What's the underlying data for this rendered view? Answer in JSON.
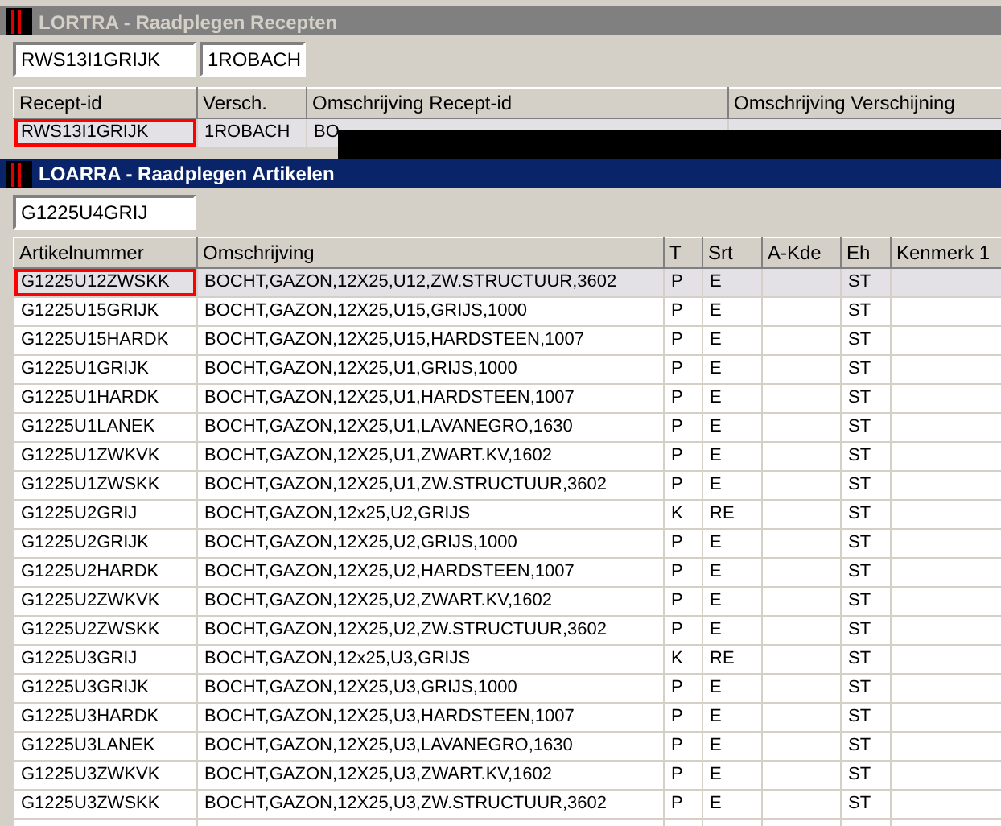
{
  "recipes_window": {
    "title": "LORTRA - Raadplegen Recepten",
    "filters": [
      "RWS13I1GRIJK",
      "1ROBACH"
    ],
    "columns": [
      "Recept-id",
      "Versch.",
      "Omschrijving Recept-id",
      "Omschrijving Verschijning"
    ],
    "rows": [
      {
        "cells": [
          "RWS13I1GRIJK",
          "1ROBACH",
          "BO",
          ""
        ],
        "selected": true
      }
    ]
  },
  "articles_window": {
    "title": "LOARRA - Raadplegen Artikelen",
    "filter": "G1225U4GRIJ",
    "columns": [
      "Artikelnummer",
      "Omschrijving",
      "T",
      "Srt",
      "A-Kde",
      "Eh",
      "Kenmerk 1"
    ],
    "rows": [
      {
        "cells": [
          "G1225U12ZWSKK",
          "BOCHT,GAZON,12X25,U12,ZW.STRUCTUUR,3602",
          "P",
          "E",
          "",
          "ST",
          ""
        ],
        "selected": true
      },
      {
        "cells": [
          "G1225U15GRIJK",
          "BOCHT,GAZON,12X25,U15,GRIJS,1000",
          "P",
          "E",
          "",
          "ST",
          ""
        ],
        "selected": false
      },
      {
        "cells": [
          "G1225U15HARDK",
          "BOCHT,GAZON,12X25,U15,HARDSTEEN,1007",
          "P",
          "E",
          "",
          "ST",
          ""
        ],
        "selected": false
      },
      {
        "cells": [
          "G1225U1GRIJK",
          "BOCHT,GAZON,12X25,U1,GRIJS,1000",
          "P",
          "E",
          "",
          "ST",
          ""
        ],
        "selected": false
      },
      {
        "cells": [
          "G1225U1HARDK",
          "BOCHT,GAZON,12X25,U1,HARDSTEEN,1007",
          "P",
          "E",
          "",
          "ST",
          ""
        ],
        "selected": false
      },
      {
        "cells": [
          "G1225U1LANEK",
          "BOCHT,GAZON,12X25,U1,LAVANEGRO,1630",
          "P",
          "E",
          "",
          "ST",
          ""
        ],
        "selected": false
      },
      {
        "cells": [
          "G1225U1ZWKVK",
          "BOCHT,GAZON,12X25,U1,ZWART.KV,1602",
          "P",
          "E",
          "",
          "ST",
          ""
        ],
        "selected": false
      },
      {
        "cells": [
          "G1225U1ZWSKK",
          "BOCHT,GAZON,12X25,U1,ZW.STRUCTUUR,3602",
          "P",
          "E",
          "",
          "ST",
          ""
        ],
        "selected": false
      },
      {
        "cells": [
          "G1225U2GRIJ",
          "BOCHT,GAZON,12x25,U2,GRIJS",
          "K",
          "RE",
          "",
          "ST",
          ""
        ],
        "selected": false
      },
      {
        "cells": [
          "G1225U2GRIJK",
          "BOCHT,GAZON,12X25,U2,GRIJS,1000",
          "P",
          "E",
          "",
          "ST",
          ""
        ],
        "selected": false
      },
      {
        "cells": [
          "G1225U2HARDK",
          "BOCHT,GAZON,12X25,U2,HARDSTEEN,1007",
          "P",
          "E",
          "",
          "ST",
          ""
        ],
        "selected": false
      },
      {
        "cells": [
          "G1225U2ZWKVK",
          "BOCHT,GAZON,12X25,U2,ZWART.KV,1602",
          "P",
          "E",
          "",
          "ST",
          ""
        ],
        "selected": false
      },
      {
        "cells": [
          "G1225U2ZWSKK",
          "BOCHT,GAZON,12X25,U2,ZW.STRUCTUUR,3602",
          "P",
          "E",
          "",
          "ST",
          ""
        ],
        "selected": false
      },
      {
        "cells": [
          "G1225U3GRIJ",
          "BOCHT,GAZON,12x25,U3,GRIJS",
          "K",
          "RE",
          "",
          "ST",
          ""
        ],
        "selected": false
      },
      {
        "cells": [
          "G1225U3GRIJK",
          "BOCHT,GAZON,12X25,U3,GRIJS,1000",
          "P",
          "E",
          "",
          "ST",
          ""
        ],
        "selected": false
      },
      {
        "cells": [
          "G1225U3HARDK",
          "BOCHT,GAZON,12X25,U3,HARDSTEEN,1007",
          "P",
          "E",
          "",
          "ST",
          ""
        ],
        "selected": false
      },
      {
        "cells": [
          "G1225U3LANEK",
          "BOCHT,GAZON,12X25,U3,LAVANEGRO,1630",
          "P",
          "E",
          "",
          "ST",
          ""
        ],
        "selected": false
      },
      {
        "cells": [
          "G1225U3ZWKVK",
          "BOCHT,GAZON,12X25,U3,ZWART.KV,1602",
          "P",
          "E",
          "",
          "ST",
          ""
        ],
        "selected": false
      },
      {
        "cells": [
          "G1225U3ZWSKK",
          "BOCHT,GAZON,12X25,U3,ZW.STRUCTUUR,3602",
          "P",
          "E",
          "",
          "ST",
          ""
        ],
        "selected": false
      }
    ]
  }
}
